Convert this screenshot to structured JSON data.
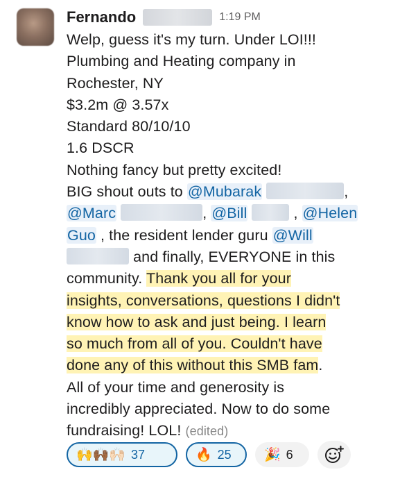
{
  "message": {
    "author": "Fernando",
    "timestamp": "1:19 PM",
    "lines": [
      "Welp, guess it's my turn.  Under LOI!!!",
      "Plumbing and Heating company in",
      "Rochester, NY",
      "$3.2m @ 3.57x",
      "Standard 80/10/10",
      "1.6 DSCR",
      "Nothing fancy but pretty excited!"
    ],
    "shout_prefix": "BIG shout outs to ",
    "mentions": {
      "mubarak": "@Mubarak",
      "marc": "@Marc",
      "bill": "@Bill",
      "helen_first": "@Helen",
      "helen_last": "Guo",
      "will": "@Will"
    },
    "sep_comma": ",",
    "sep_comma_space": ", ",
    "sep_space_comma": " , ",
    "lender_text": " , the resident lender guru ",
    "finally_text": " and finally, EVERYONE in this",
    "community_text": "community.  ",
    "highlight_lines": [
      "Thank you all for your",
      "insights, conversations, questions I didn't",
      "know how to ask and just being.  I learn",
      "so much from all of you.  Couldn't have",
      "done any of this without this SMB fam"
    ],
    "period": ".",
    "closing_lines": [
      "All of your time and generosity is",
      "incredibly appreciated.  Now to do some",
      "fundraising!  LOL! "
    ],
    "edited": "(edited)"
  },
  "reactions": [
    {
      "emoji": "🙌🙌🏾🙌🏻",
      "count": "37",
      "active": true
    },
    {
      "emoji": "🔥",
      "count": "25",
      "active": true
    },
    {
      "emoji": "🎉",
      "count": "6",
      "active": false
    }
  ],
  "add_reaction_icon": "add-emoji-icon"
}
